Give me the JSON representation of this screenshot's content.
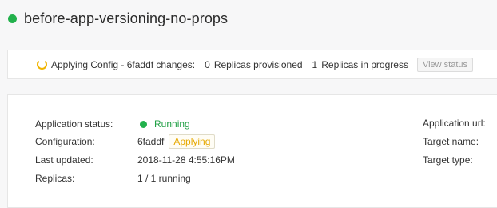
{
  "app": {
    "name": "before-app-versioning-no-props",
    "status_color": "#22b14c"
  },
  "banner": {
    "icon": "spinner-icon",
    "message": "Applying Config - 6faddf changes:",
    "provisioned_count": "0",
    "provisioned_label": "Replicas provisioned",
    "in_progress_count": "1",
    "in_progress_label": "Replicas in progress",
    "view_status_label": "View status"
  },
  "details": {
    "status_label": "Application status:",
    "status_value": "Running",
    "configuration_label": "Configuration:",
    "configuration_value": "6faddf",
    "configuration_badge": "Applying",
    "updated_label": "Last updated:",
    "updated_value": "2018-11-28 4:55:16PM",
    "replicas_label": "Replicas:",
    "replicas_value": "1 / 1 running",
    "url_label": "Application url:",
    "target_name_label": "Target name:",
    "target_type_label": "Target type:"
  },
  "colors": {
    "running": "#22a046",
    "applying": "#e6a800"
  }
}
